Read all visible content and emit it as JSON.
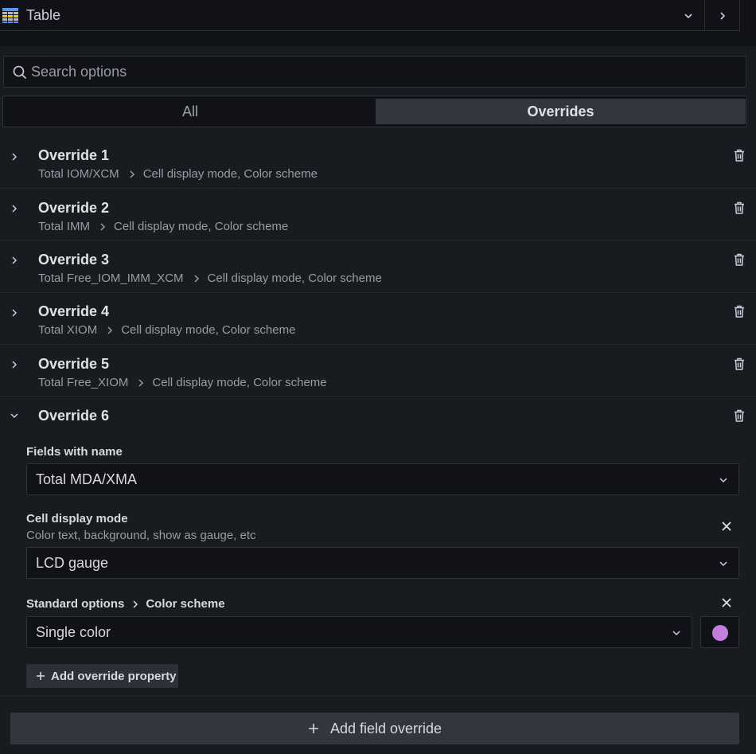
{
  "header": {
    "viz_title": "Table",
    "viz_icon": "table-icon"
  },
  "search": {
    "placeholder": "Search options"
  },
  "tabs": [
    {
      "label": "All",
      "active": false
    },
    {
      "label": "Overrides",
      "active": true
    }
  ],
  "overrides": [
    {
      "title": "Override 1",
      "field": "Total IOM/XCM",
      "properties": "Cell display mode, Color scheme"
    },
    {
      "title": "Override 2",
      "field": "Total IMM",
      "properties": "Cell display mode, Color scheme"
    },
    {
      "title": "Override 3",
      "field": "Total Free_IOM_IMM_XCM",
      "properties": "Cell display mode, Color scheme"
    },
    {
      "title": "Override 4",
      "field": "Total XIOM",
      "properties": "Cell display mode, Color scheme"
    },
    {
      "title": "Override 5",
      "field": "Total Free_XIOM",
      "properties": "Cell display mode, Color scheme"
    }
  ],
  "expanded_override": {
    "title": "Override 6",
    "matcher": {
      "label": "Fields with name",
      "value": "Total MDA/XMA"
    },
    "cell_display_mode": {
      "label": "Cell display mode",
      "description": "Color text, background, show as gauge, etc",
      "value": "LCD gauge"
    },
    "color_scheme": {
      "category": "Standard options",
      "label": "Color scheme",
      "value": "Single color",
      "color": "#c07fdc"
    },
    "add_property_label": "Add override property"
  },
  "add_field_override_label": "Add field override",
  "colors": {
    "background": "#181b1f",
    "panel": "#111217",
    "button": "#33363d"
  }
}
